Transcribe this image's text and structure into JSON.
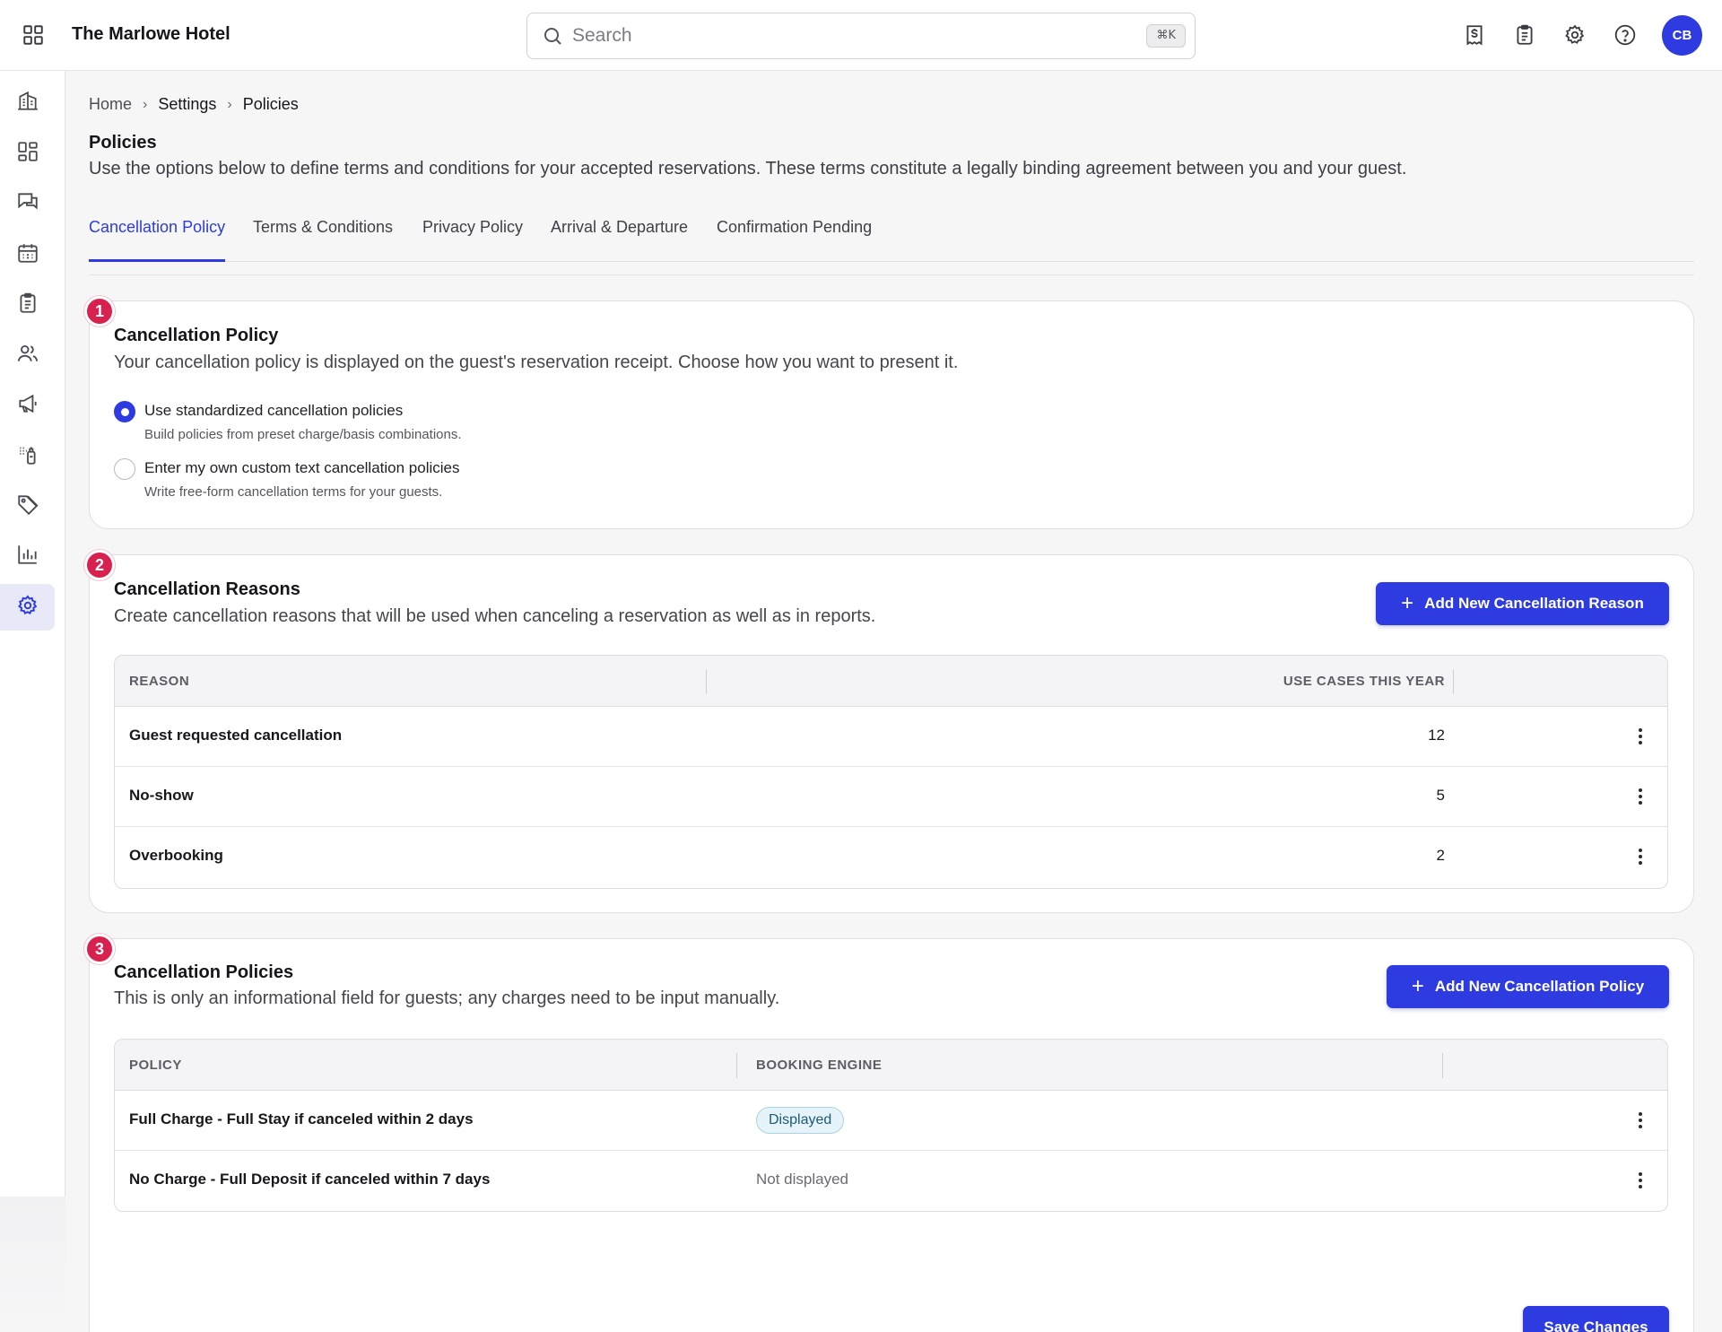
{
  "app": {
    "hotel_name": "The Marlowe Hotel",
    "avatar_initials": "CB",
    "accent": "#2d3be0",
    "step_badge_color": "#d9214f"
  },
  "search": {
    "placeholder": "Search",
    "shortcut": "⌘K"
  },
  "topbar_icons": [
    "receipt-dollar-icon",
    "clipboard-icon",
    "gear-icon",
    "help-icon"
  ],
  "sidebar": {
    "items": [
      {
        "icon": "building-icon",
        "active": false
      },
      {
        "icon": "dashboard-icon",
        "active": false
      },
      {
        "icon": "messages-icon",
        "active": false
      },
      {
        "icon": "calendar-icon",
        "active": false
      },
      {
        "icon": "clipboard-list-icon",
        "active": false
      },
      {
        "icon": "users-icon",
        "active": false
      },
      {
        "icon": "megaphone-icon",
        "active": false
      },
      {
        "icon": "housekeeping-icon",
        "active": false
      },
      {
        "icon": "tag-icon",
        "active": false
      },
      {
        "icon": "bar-chart-icon",
        "active": false
      },
      {
        "icon": "settings-icon",
        "active": true
      }
    ]
  },
  "breadcrumb": [
    "Home",
    "Settings",
    "Policies"
  ],
  "page": {
    "title": "Policies",
    "description": "Use the options below to define terms and conditions for your accepted reservations. These terms constitute a legally binding agreement between you and your guest."
  },
  "tabs": [
    {
      "label": "Cancellation Policy",
      "active": true
    },
    {
      "label": "Terms & Conditions",
      "active": false
    },
    {
      "label": "Privacy Policy",
      "active": false
    },
    {
      "label": "Arrival & Departure",
      "active": false
    },
    {
      "label": "Confirmation Pending",
      "active": false
    }
  ],
  "section1": {
    "step": "1",
    "title": "Cancellation Policy",
    "description": "Your cancellation policy is displayed on the guest's reservation receipt. Choose how you want to present it.",
    "options": [
      {
        "label": "Use standardized cancellation policies",
        "sub": "Build policies from preset charge/basis combinations.",
        "selected": true
      },
      {
        "label": "Enter my own custom text cancellation policies",
        "sub": "Write free-form cancellation terms for your guests.",
        "selected": false
      }
    ]
  },
  "section2": {
    "step": "2",
    "title": "Cancellation Reasons",
    "description": "Create cancellation reasons that will be used when canceling a reservation as well as in reports.",
    "add_button": "Add New Cancellation Reason",
    "columns": [
      "REASON",
      "USE CASES THIS YEAR"
    ],
    "rows": [
      {
        "reason": "Guest requested cancellation",
        "count": "12"
      },
      {
        "reason": "No-show",
        "count": "5"
      },
      {
        "reason": "Overbooking",
        "count": "2"
      }
    ]
  },
  "section3": {
    "step": "3",
    "title": "Cancellation Policies",
    "description": "This is only an informational field for guests; any charges need to be input manually.",
    "add_button": "Add New Cancellation Policy",
    "columns": [
      "POLICY",
      "BOOKING ENGINE"
    ],
    "rows": [
      {
        "policy": "Full Charge - Full Stay if canceled within 2 days",
        "engine": "Displayed",
        "displayed": true
      },
      {
        "policy": "No Charge - Full Deposit if canceled within 7 days",
        "engine": "Not displayed",
        "displayed": false
      }
    ],
    "save_button": "Save Changes"
  }
}
